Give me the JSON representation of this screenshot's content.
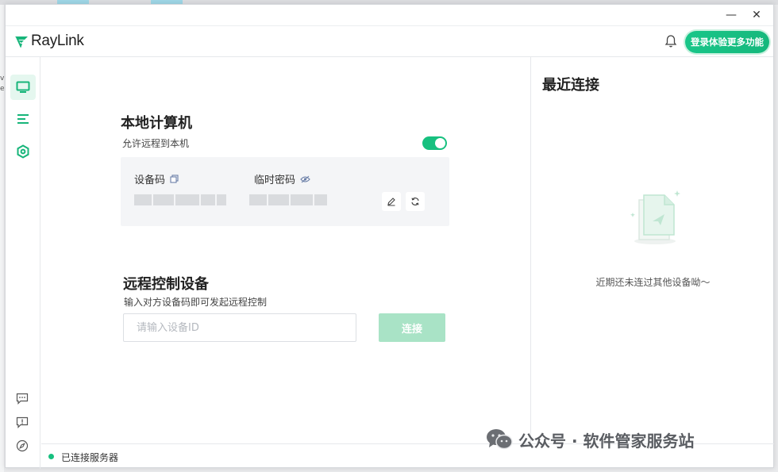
{
  "app": {
    "name": "RayLink"
  },
  "desktop": {
    "edge_chars": [
      "v",
      "e"
    ]
  },
  "window_controls": {
    "minimize": "—",
    "close": "✕"
  },
  "header": {
    "cta_label": "登录体验更多功能"
  },
  "sidebar": {
    "items": [
      "monitor-icon",
      "list-icon",
      "settings-hex-icon"
    ],
    "bottom": [
      "chat-icon",
      "feedback-icon",
      "compass-icon"
    ]
  },
  "local": {
    "title": "本地计算机",
    "allow_label": "允许远程到本机",
    "allow_enabled": true,
    "device_code_label": "设备码",
    "temp_password_label": "临时密码"
  },
  "remote": {
    "title": "远程控制设备",
    "subtitle": "输入对方设备码即可发起远程控制",
    "input_placeholder": "请输入设备ID",
    "input_value": "",
    "connect_label": "连接"
  },
  "recent": {
    "title": "最近连接",
    "empty_text": "近期还未连过其他设备呦～"
  },
  "status": {
    "text": "已连接服务器"
  },
  "watermark": {
    "text": "公众号 · 软件管家服务站"
  },
  "colors": {
    "accent": "#17c07f",
    "connect_disabled": "#a9e3c6"
  }
}
